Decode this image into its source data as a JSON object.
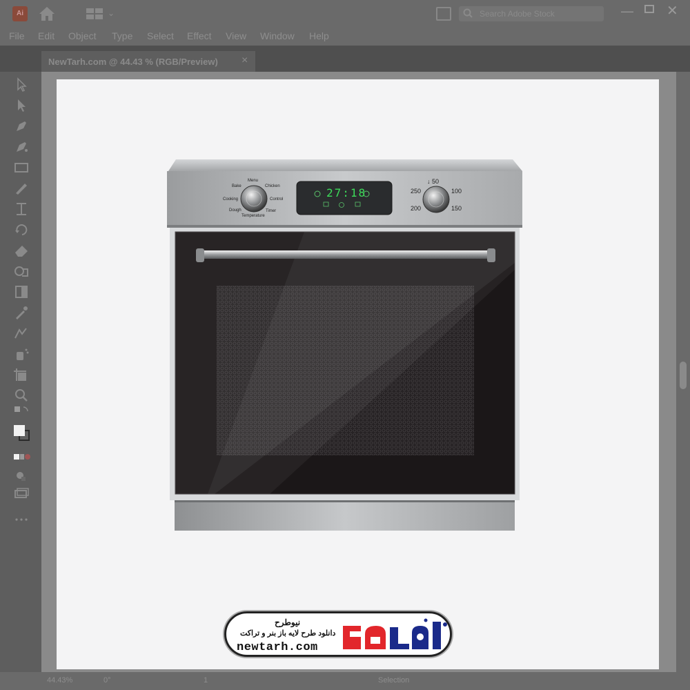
{
  "window": {
    "app_icon_label": "Ai",
    "search_placeholder": "Search Adobe Stock"
  },
  "menu": {
    "items": [
      "File",
      "Edit",
      "Object",
      "Type",
      "Select",
      "Effect",
      "View",
      "Window",
      "Help"
    ]
  },
  "document_tab": {
    "title": "NewTarh.com @ 44.43 % (RGB/Preview)",
    "close_label": "×"
  },
  "toolbar": {
    "tools": [
      "selection-tool-icon",
      "direct-selection-tool-icon",
      "pen-tool-icon",
      "curvature-tool-icon",
      "rectangle-tool-icon",
      "brush-tool-icon",
      "width-tool-icon",
      "rotate-tool-icon",
      "eraser-tool-icon",
      "shape-builder-tool-icon",
      "gradient-tool-icon",
      "eyedropper-tool-icon",
      "blend-tool-icon",
      "symbol-sprayer-tool-icon",
      "artboard-tool-icon",
      "zoom-tool-icon",
      "swap-colors-icon",
      "fill-stroke-icon",
      "color-mode-icon",
      "drawing-mode-icon",
      "screen-mode-icon",
      "more-tools-icon"
    ]
  },
  "status": {
    "zoom": "44.43%",
    "angle": "0°",
    "page": "1",
    "tool": "Selection"
  },
  "oven": {
    "labels": {
      "menu": "Menu",
      "bake": "Bake",
      "chicken": "Chicken",
      "cooking": "Cooking",
      "control": "Control",
      "dough": "Dough",
      "timer": "Timer",
      "temperature": "Temperature"
    },
    "display": "27:18",
    "temp_marks": {
      "top": "↓ 50",
      "left_top": "250",
      "right_top": "100",
      "left_bottom": "200",
      "right_bottom": "150"
    }
  },
  "watermark": {
    "title": "نیوطرح",
    "subtitle": "دانلود طرح لایه باز بنر و تراکت",
    "url": "newtarh.com",
    "logo_text": "نیوطرح"
  },
  "colors": {
    "ui_dark": "#5e5e5e",
    "artboard": "#f4f4f5",
    "oven_steel": "#b8babc",
    "oven_glass": "#1b1718",
    "display_green": "#3ddc5a",
    "logo_red": "#e2262b"
  }
}
